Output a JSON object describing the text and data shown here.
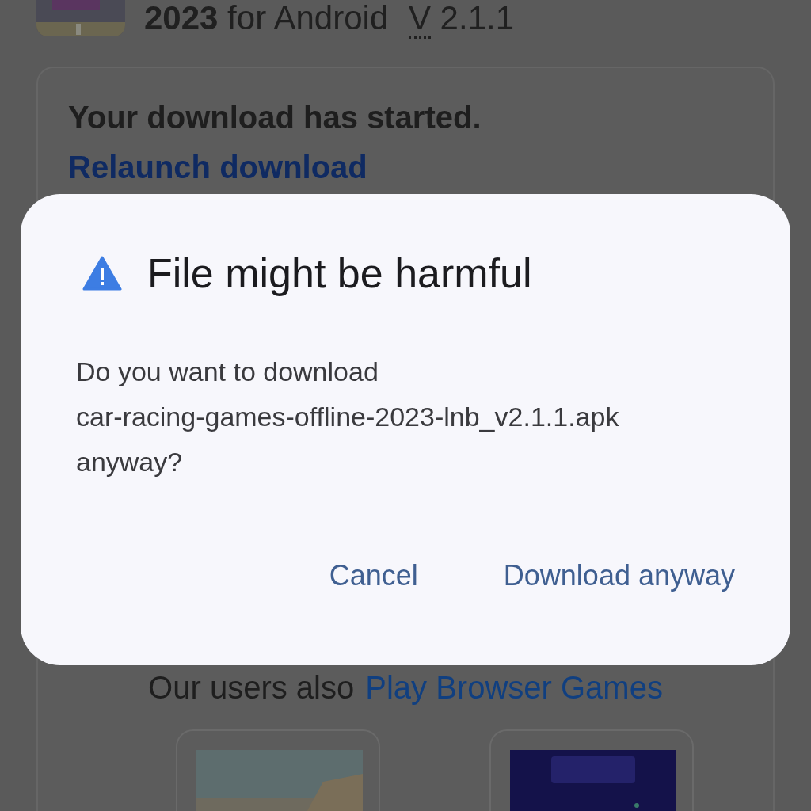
{
  "page": {
    "app_title": {
      "year": "2023",
      "rest": "for Android",
      "version_abbr": "V",
      "version": "2.1.1"
    },
    "download_card": {
      "message": "Your download has started.",
      "relaunch_link": "Relaunch download",
      "promo_text": "Our users also",
      "promo_link": "Play Browser Games"
    }
  },
  "dialog": {
    "title": "File might be harmful",
    "message": [
      "Do you want to download",
      "car-racing-games-offline-2023-lnb_v2.1.1.apk",
      "anyway?"
    ],
    "buttons": [
      "Cancel",
      "Download anyway"
    ]
  }
}
